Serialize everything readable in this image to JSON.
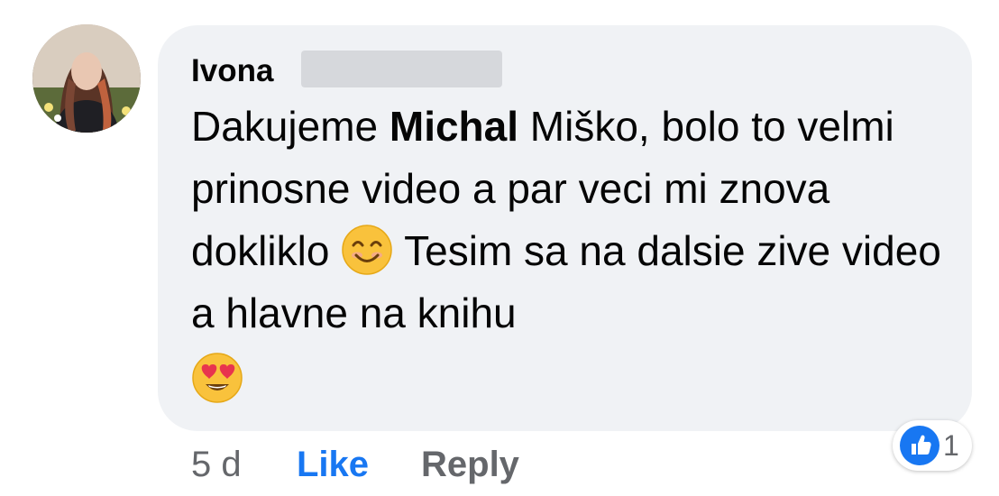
{
  "comment": {
    "author": "Ivona",
    "text_before_mention": "Dakujeme ",
    "mention": "Michal",
    "text_after_mention": " Miško, bolo to velmi prinosne video a par veci mi znova dokliklo ",
    "text_after_emoji": " Tesim sa na dalsie zive video a hlavne na knihu",
    "emojis": [
      "smiling-face-emoji",
      "heart-eyes-emoji"
    ]
  },
  "actions": {
    "time": "5 d",
    "like_label": "Like",
    "reply_label": "Reply"
  },
  "reactions": {
    "icon": "thumbs-up-icon",
    "count": "1"
  },
  "colors": {
    "bubble": "#f0f2f5",
    "like_blue": "#1877f2",
    "secondary_text": "#65676b"
  }
}
